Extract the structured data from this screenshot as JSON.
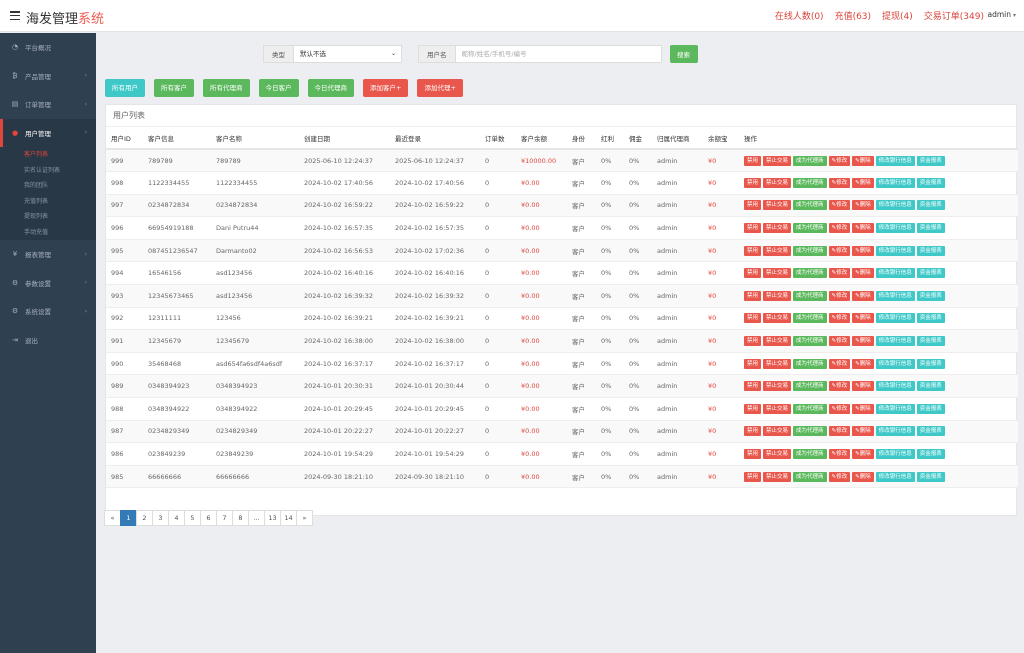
{
  "header": {
    "brand_main": "海发管理",
    "brand_accent": "系统",
    "nav": [
      {
        "label": "在线人数(0)"
      },
      {
        "label": "充值(63)"
      },
      {
        "label": "提现(4)"
      },
      {
        "label": "交易订单(349)"
      }
    ],
    "user": "admin"
  },
  "sidebar": {
    "items": [
      {
        "label": "平台概况",
        "icon": "dashboard-icon"
      },
      {
        "label": "产品管理",
        "icon": "bitcoin-icon"
      },
      {
        "label": "订单管理",
        "icon": "document-icon"
      },
      {
        "label": "用户管理",
        "icon": "user-icon"
      },
      {
        "label": "报表管理",
        "icon": "yen-icon"
      },
      {
        "label": "参数设置",
        "icon": "gear-icon"
      },
      {
        "label": "系统设置",
        "icon": "gears-icon"
      },
      {
        "label": "退出",
        "icon": "logout-icon"
      }
    ],
    "submenu": [
      {
        "label": "客户列表"
      },
      {
        "label": "实名认证列表"
      },
      {
        "label": "我的团队"
      },
      {
        "label": "充值列表"
      },
      {
        "label": "提现列表"
      },
      {
        "label": "手动充值"
      }
    ]
  },
  "filter": {
    "type_label": "类型",
    "type_value": "默认不选",
    "user_label": "用户名",
    "user_placeholder": "昵称/姓名/手机号/编号",
    "search_label": "搜索"
  },
  "tabs": [
    {
      "label": "所有用户"
    },
    {
      "label": "所有客户"
    },
    {
      "label": "所有代理商"
    },
    {
      "label": "今日客户"
    },
    {
      "label": "今日代理商"
    },
    {
      "label": "添加客户+"
    },
    {
      "label": "添加代理+"
    }
  ],
  "panel_title": "用户列表",
  "table": {
    "columns": [
      "用户ID",
      "客户信息",
      "客户名称",
      "创建日期",
      "最近登录",
      "订单数",
      "客户余额",
      "身份",
      "红利",
      "佣金",
      "归属代理商",
      "余额宝",
      "操作"
    ],
    "rows": [
      {
        "id": "999",
        "info": "789789",
        "name": "789789",
        "created": "2025-06-10 12:24:37",
        "login": "2025-06-10 12:24:37",
        "orders": "0",
        "balance": "¥10000.00",
        "role": "客户",
        "bonus": "0%",
        "commission": "0%",
        "agent": "admin",
        "yeb": "¥0"
      },
      {
        "id": "998",
        "info": "1122334455",
        "name": "1122334455",
        "created": "2024-10-02 17:40:56",
        "login": "2024-10-02 17:40:56",
        "orders": "0",
        "balance": "¥0.00",
        "role": "客户",
        "bonus": "0%",
        "commission": "0%",
        "agent": "admin",
        "yeb": "¥0"
      },
      {
        "id": "997",
        "info": "0234872834",
        "name": "0234872834",
        "created": "2024-10-02 16:59:22",
        "login": "2024-10-02 16:59:22",
        "orders": "0",
        "balance": "¥0.00",
        "role": "客户",
        "bonus": "0%",
        "commission": "0%",
        "agent": "admin",
        "yeb": "¥0"
      },
      {
        "id": "996",
        "info": "66954919188",
        "name": "Dani Putru44",
        "created": "2024-10-02 16:57:35",
        "login": "2024-10-02 16:57:35",
        "orders": "0",
        "balance": "¥0.00",
        "role": "客户",
        "bonus": "0%",
        "commission": "0%",
        "agent": "admin",
        "yeb": "¥0"
      },
      {
        "id": "995",
        "info": "087451236547",
        "name": "Darmanto02",
        "created": "2024-10-02 16:56:53",
        "login": "2024-10-02 17:02:36",
        "orders": "0",
        "balance": "¥0.00",
        "role": "客户",
        "bonus": "0%",
        "commission": "0%",
        "agent": "admin",
        "yeb": "¥0"
      },
      {
        "id": "994",
        "info": "16546156",
        "name": "asd123456",
        "created": "2024-10-02 16:40:16",
        "login": "2024-10-02 16:40:16",
        "orders": "0",
        "balance": "¥0.00",
        "role": "客户",
        "bonus": "0%",
        "commission": "0%",
        "agent": "admin",
        "yeb": "¥0"
      },
      {
        "id": "993",
        "info": "12345673465",
        "name": "asd123456",
        "created": "2024-10-02 16:39:32",
        "login": "2024-10-02 16:39:32",
        "orders": "0",
        "balance": "¥0.00",
        "role": "客户",
        "bonus": "0%",
        "commission": "0%",
        "agent": "admin",
        "yeb": "¥0"
      },
      {
        "id": "992",
        "info": "12311111",
        "name": "123456",
        "created": "2024-10-02 16:39:21",
        "login": "2024-10-02 16:39:21",
        "orders": "0",
        "balance": "¥0.00",
        "role": "客户",
        "bonus": "0%",
        "commission": "0%",
        "agent": "admin",
        "yeb": "¥0"
      },
      {
        "id": "991",
        "info": "12345679",
        "name": "12345679",
        "created": "2024-10-02 16:38:00",
        "login": "2024-10-02 16:38:00",
        "orders": "0",
        "balance": "¥0.00",
        "role": "客户",
        "bonus": "0%",
        "commission": "0%",
        "agent": "admin",
        "yeb": "¥0"
      },
      {
        "id": "990",
        "info": "35468468",
        "name": "asd654fa6sdf4a6sdf",
        "created": "2024-10-02 16:37:17",
        "login": "2024-10-02 16:37:17",
        "orders": "0",
        "balance": "¥0.00",
        "role": "客户",
        "bonus": "0%",
        "commission": "0%",
        "agent": "admin",
        "yeb": "¥0"
      },
      {
        "id": "989",
        "info": "0348394923",
        "name": "0348394923",
        "created": "2024-10-01 20:30:31",
        "login": "2024-10-01 20:30:44",
        "orders": "0",
        "balance": "¥0.00",
        "role": "客户",
        "bonus": "0%",
        "commission": "0%",
        "agent": "admin",
        "yeb": "¥0"
      },
      {
        "id": "988",
        "info": "0348394922",
        "name": "0348394922",
        "created": "2024-10-01 20:29:45",
        "login": "2024-10-01 20:29:45",
        "orders": "0",
        "balance": "¥0.00",
        "role": "客户",
        "bonus": "0%",
        "commission": "0%",
        "agent": "admin",
        "yeb": "¥0"
      },
      {
        "id": "987",
        "info": "0234829349",
        "name": "0234829349",
        "created": "2024-10-01 20:22:27",
        "login": "2024-10-01 20:22:27",
        "orders": "0",
        "balance": "¥0.00",
        "role": "客户",
        "bonus": "0%",
        "commission": "0%",
        "agent": "admin",
        "yeb": "¥0"
      },
      {
        "id": "986",
        "info": "023849239",
        "name": "023849239",
        "created": "2024-10-01 19:54:29",
        "login": "2024-10-01 19:54:29",
        "orders": "0",
        "balance": "¥0.00",
        "role": "客户",
        "bonus": "0%",
        "commission": "0%",
        "agent": "admin",
        "yeb": "¥0"
      },
      {
        "id": "985",
        "info": "66666666",
        "name": "66666666",
        "created": "2024-09-30 18:21:10",
        "login": "2024-09-30 18:21:10",
        "orders": "0",
        "balance": "¥0.00",
        "role": "客户",
        "bonus": "0%",
        "commission": "0%",
        "agent": "admin",
        "yeb": "¥0"
      }
    ],
    "actions": [
      {
        "label": "禁用",
        "color": "red"
      },
      {
        "label": "禁止交易",
        "color": "red"
      },
      {
        "label": "成为代理商",
        "color": "green"
      },
      {
        "label": "✎修改",
        "color": "red"
      },
      {
        "label": "✎删除",
        "color": "red"
      },
      {
        "label": "修改银行信息",
        "color": "teal"
      },
      {
        "label": "资金报表",
        "color": "teal"
      }
    ]
  },
  "pagination": [
    "«",
    "1",
    "2",
    "3",
    "4",
    "5",
    "6",
    "7",
    "8",
    "...",
    "13",
    "14",
    "»"
  ],
  "pagination_active": "1",
  "colors": {
    "accent_red": "#e0463c",
    "sidebar_bg": "#2f4050",
    "green": "#5cb85c",
    "teal": "#3ec8c8",
    "page_active": "#337ab7"
  }
}
